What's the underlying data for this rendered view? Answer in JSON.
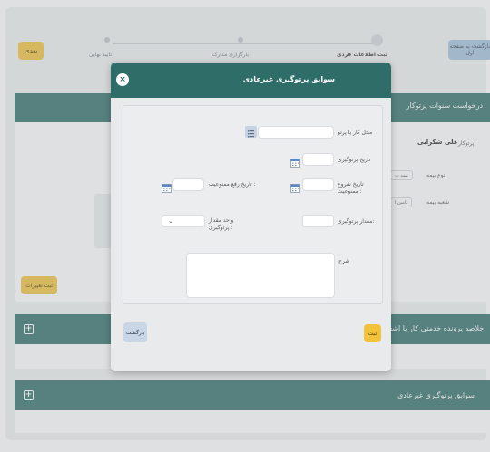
{
  "header": {
    "next_label": "بعدی",
    "back_label": "بازگشت به صفحه اول",
    "steps": [
      {
        "label": "ثبت اطلاعات فردی"
      },
      {
        "label": "بارگزاری مدارک"
      },
      {
        "label": "تایید نهایی"
      }
    ]
  },
  "panel_request": {
    "title": "درخواست سنوات پرتوکار",
    "worker_label": "پرتوکار:",
    "worker_name": "علی شکرایی",
    "insurance_type_label": "نوع بیمه",
    "insurance_type_value": "بیمه ت",
    "insurance_branch_label": "شعبه بیمه",
    "insurance_branch_value": "تامین ا",
    "save_changes_label": "ثبت تغییرات"
  },
  "panel_summary": {
    "title": "خلاصه پرونده خدمتی کار با اشعه متقاضی",
    "plus": "+"
  },
  "panel_irregular": {
    "title": "سوابق پرتوگیری غیرعادی",
    "plus": "+"
  },
  "modal": {
    "title": "سوابق پرتوگیری غیرعادی",
    "close_glyph": "×",
    "fields": {
      "workplace_label": "محل کار یا پرتو",
      "exposure_date_label": "تاریخ پرتوگیری",
      "restriction_start_label": "تاریخ شروع ممنوعیت :",
      "restriction_end_label": "تاریخ رفع ممنوعیت :",
      "exposure_amount_label": "مقدار پرتوگیری:",
      "exposure_unit_label": "واحد مقدار پرتوگیری :",
      "description_label": "شرح"
    },
    "save_label": "ثبت",
    "return_label": "بازگشت"
  },
  "colors": {
    "primary": "#2e6d68",
    "accent": "#f3c23b",
    "secondary": "#a5c1dd"
  }
}
